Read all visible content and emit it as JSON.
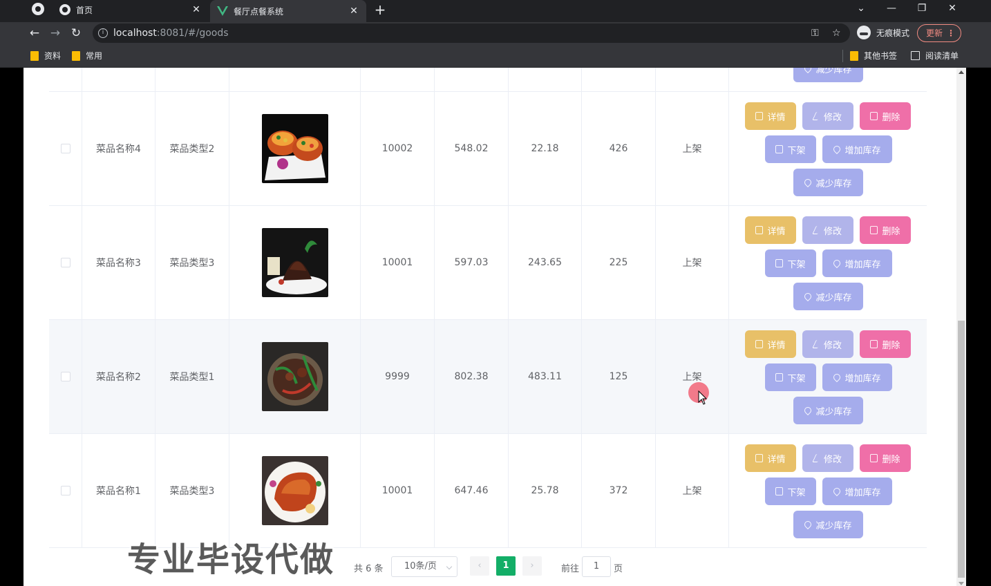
{
  "browser": {
    "tabs": [
      {
        "title": "首页"
      },
      {
        "title": "餐厅点餐系统"
      }
    ],
    "url_host": "localhost",
    "url_rest": ":8081/#/goods",
    "incognito_label": "无痕模式",
    "update_label": "更新",
    "bookmarks": [
      "资料",
      "常用"
    ],
    "other_bookmarks": "其他书签",
    "reading_list": "阅读清单"
  },
  "table": {
    "rows": [
      {
        "name": "菜品名称4",
        "type": "菜品类型2",
        "col4": "10002",
        "col5": "548.02",
        "col6": "22.18",
        "col7": "426",
        "status": "上架",
        "thumb": "dish-bowls"
      },
      {
        "name": "菜品名称3",
        "type": "菜品类型3",
        "col4": "10001",
        "col5": "597.03",
        "col6": "243.65",
        "col7": "225",
        "status": "上架",
        "thumb": "dish-dark-plate"
      },
      {
        "name": "菜品名称2",
        "type": "菜品类型1",
        "col4": "9999",
        "col5": "802.38",
        "col6": "483.11",
        "col7": "125",
        "status": "上架",
        "thumb": "dish-peppers"
      },
      {
        "name": "菜品名称1",
        "type": "菜品类型3",
        "col4": "10001",
        "col5": "647.46",
        "col6": "25.78",
        "col7": "372",
        "status": "上架",
        "thumb": "dish-roast"
      }
    ],
    "actions": {
      "detail": "详情",
      "edit": "修改",
      "delete": "删除",
      "off_shelf": "下架",
      "add_stock": "增加库存",
      "reduce_stock": "减少库存"
    }
  },
  "pagination": {
    "total": "共 6 条",
    "page_size": "10条/页",
    "current_page": "1",
    "goto_label": "前往",
    "goto_value": "1",
    "page_unit": "页"
  },
  "watermark": "专业毕设代做",
  "colors": {
    "detail": "#e8c068",
    "edit": "#b1b4ea",
    "delete": "#ef6fa8",
    "secondary": "#a5acec",
    "pager_active": "#13ae67"
  }
}
